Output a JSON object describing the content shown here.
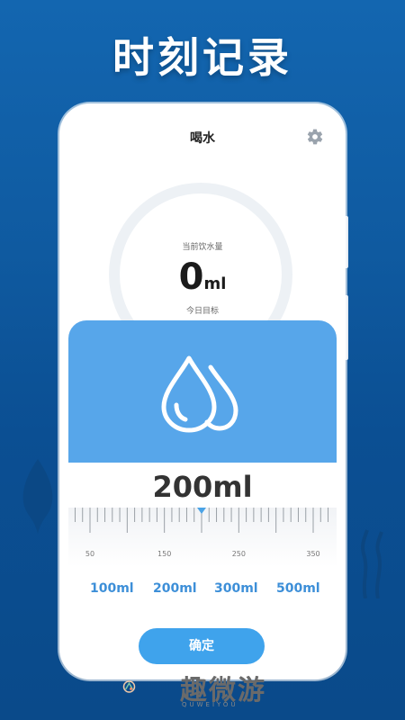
{
  "promo": {
    "headline": "时刻记录"
  },
  "app": {
    "title": "喝水",
    "current_label": "当前饮水量",
    "current_value": "0",
    "current_unit": "ml",
    "goal_label": "今日目标"
  },
  "picker": {
    "selected_amount": "200ml",
    "ruler": {
      "tick_labels": [
        "50",
        "150",
        "250",
        "350"
      ],
      "selected_value": 200
    },
    "presets": [
      "100ml",
      "200ml",
      "300ml",
      "500ml"
    ],
    "confirm_label": "确定"
  },
  "watermark": {
    "text": "趣微游",
    "sub": "QUWEIYOU"
  },
  "colors": {
    "background": "#0f5aa0",
    "accent_blue": "#57a6ea",
    "button_blue": "#3fa3ec",
    "preset_text": "#3d8fd8"
  },
  "icons": {
    "settings": "gear-icon",
    "drops": "water-drops-icon"
  }
}
